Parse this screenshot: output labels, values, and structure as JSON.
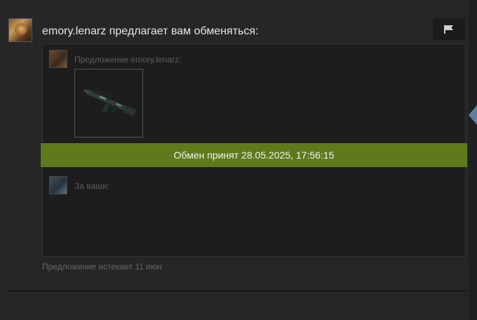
{
  "header": {
    "title": "emory.lenarz предлагает вам обменяться:"
  },
  "offer": {
    "theirs_label": "Предложение emory.lenarz:",
    "yours_label": "За ваши:",
    "item": {
      "icon": "rifle-icon"
    }
  },
  "status": {
    "accepted_text": "Обмен принят 28.05.2025, 17:56:15",
    "color": "#5f7a1b"
  },
  "footer": {
    "expires_text": "Предложение истекает 11 июн"
  },
  "icons": {
    "report": "flag-icon",
    "nav": "arrow-left-icon"
  }
}
